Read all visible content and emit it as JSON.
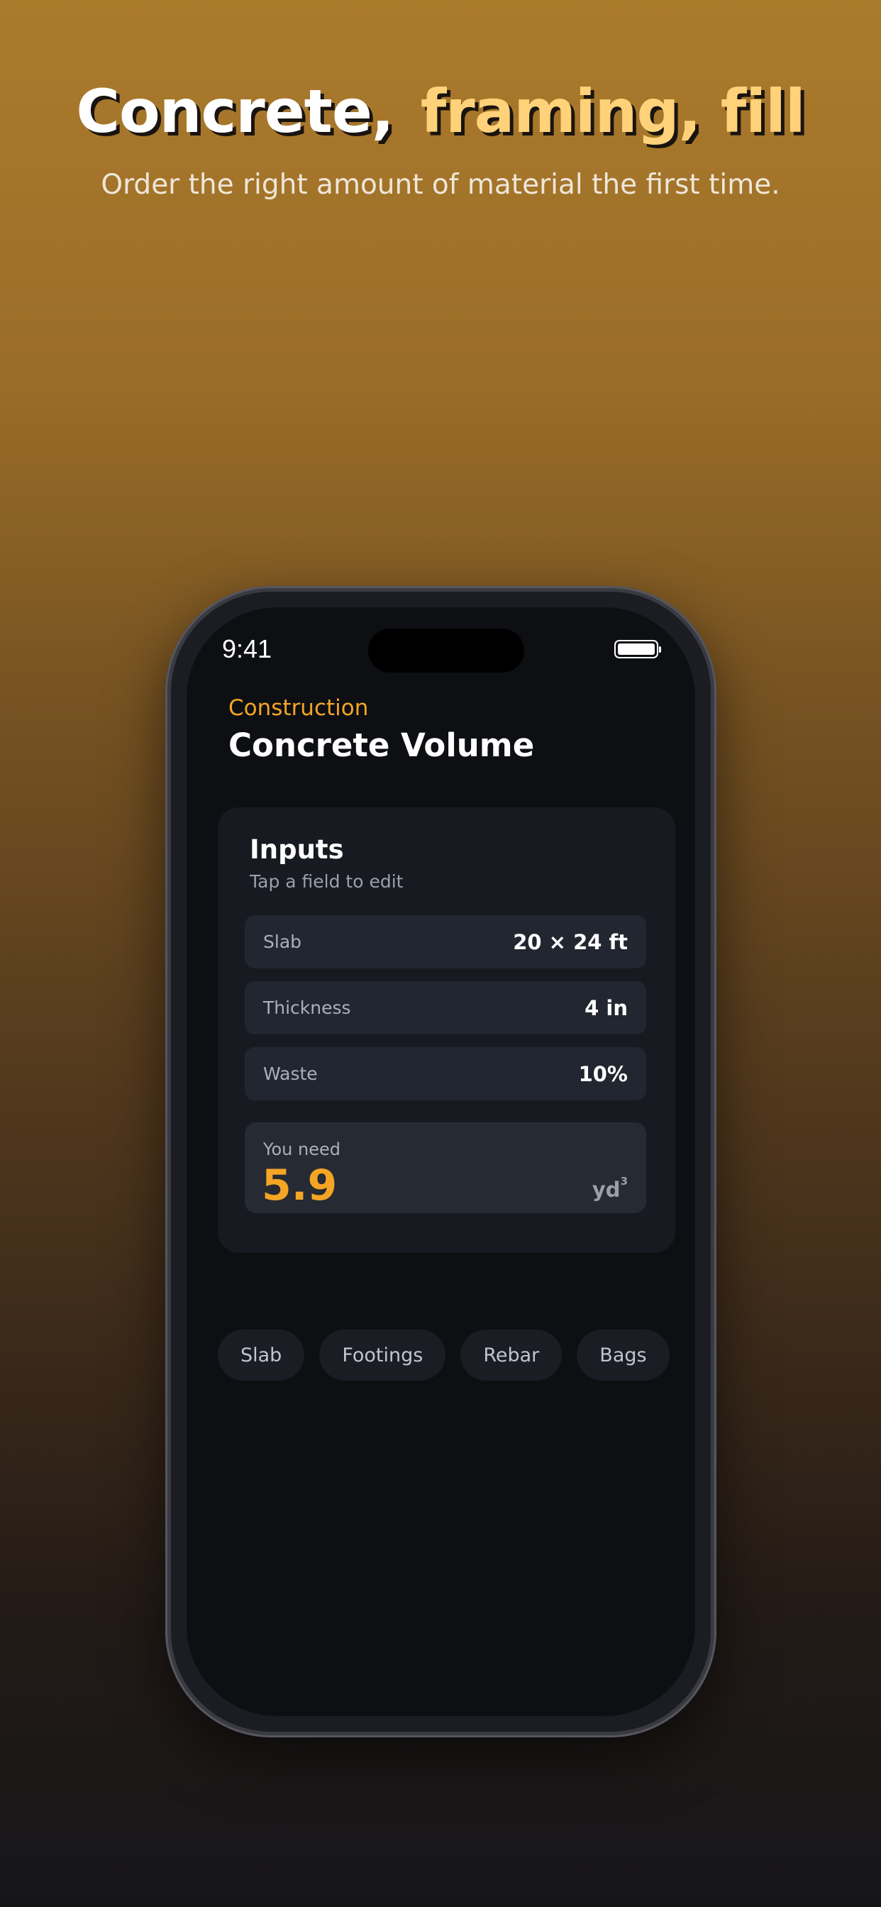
{
  "hero": {
    "headline_part1": "Concrete,",
    "headline_part2": "framing, fill",
    "subtitle": "Order the right amount of material the first time."
  },
  "status_bar": {
    "time": "9:41",
    "battery_level": 1.0
  },
  "screen": {
    "category": "Construction",
    "title": "Concrete Volume"
  },
  "inputs_card": {
    "title": "Inputs",
    "subtitle": "Tap a field to edit",
    "fields": [
      {
        "label": "Slab",
        "value": "20 × 24 ft"
      },
      {
        "label": "Thickness",
        "value": "4 in"
      },
      {
        "label": "Waste",
        "value": "10%"
      }
    ],
    "result": {
      "label": "You need",
      "value": "5.9",
      "unit": "yd",
      "unit_superscript": "3"
    }
  },
  "chips": [
    {
      "label": "Slab"
    },
    {
      "label": "Footings"
    },
    {
      "label": "Rebar"
    },
    {
      "label": "Bags"
    }
  ],
  "colors": {
    "accent": "#f5a524",
    "headline_highlight": "#ffd27a",
    "screen_bg": "#0d0f13",
    "card_bg": "#171a20"
  }
}
